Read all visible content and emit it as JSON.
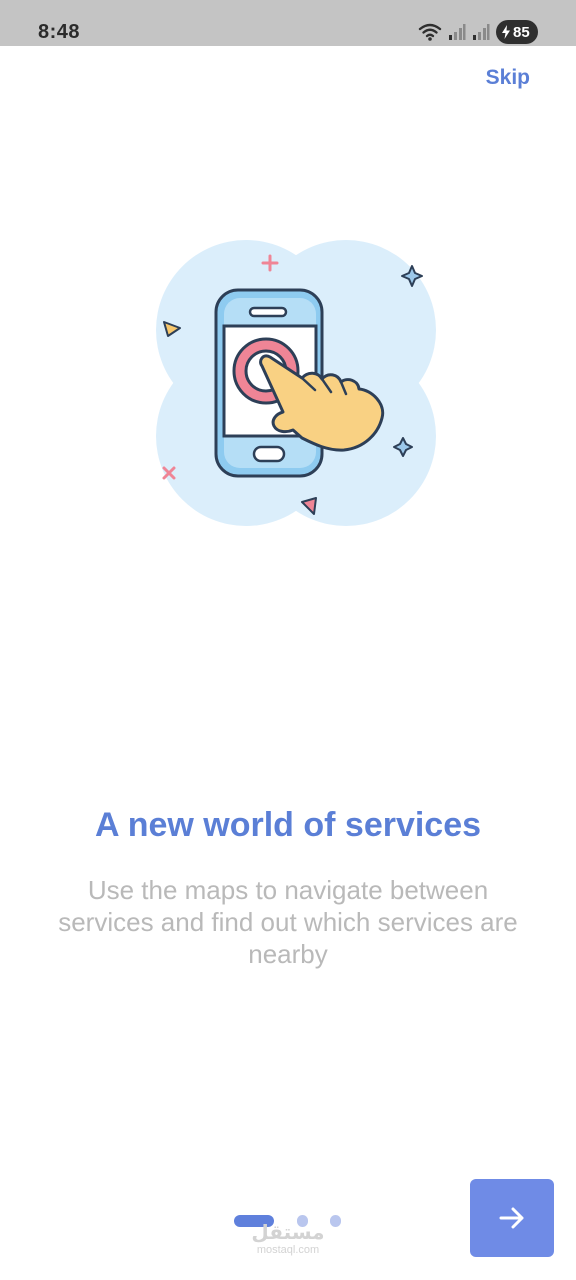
{
  "status_bar": {
    "time": "8:48",
    "battery": "85",
    "icons": [
      "wifi-icon",
      "signal-icon",
      "signal-icon",
      "charging-icon"
    ]
  },
  "header": {
    "skip_label": "Skip"
  },
  "onboarding": {
    "illustration": "phone-tap-icon",
    "title": "A new world of services",
    "description": "Use the maps to navigate between services and find out which services are nearby"
  },
  "pager": {
    "count": 3,
    "active_index": 0
  },
  "watermark": {
    "arabic": "مستقل",
    "latin": "mostaql.com"
  },
  "next_button": {
    "icon": "arrow-right-icon"
  },
  "colors": {
    "accent": "#5b7fd6",
    "button": "#6f8be6",
    "muted_text": "#b9b9b9",
    "status_bar": "#c4c4c4",
    "illustration_bg": "#dbeefb"
  }
}
